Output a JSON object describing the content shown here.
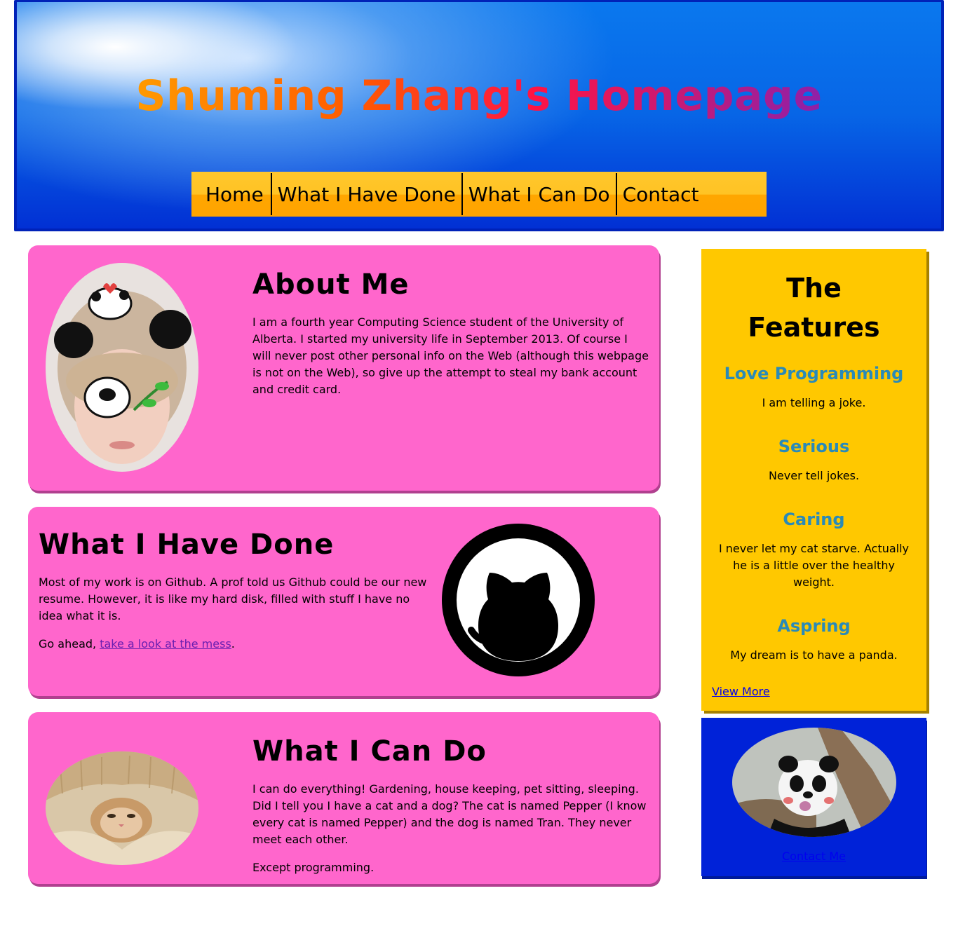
{
  "header": {
    "title": "Shuming Zhang's Homepage"
  },
  "nav": {
    "items": [
      {
        "label": "Home"
      },
      {
        "label": "What I Have Done"
      },
      {
        "label": "What I Can Do"
      },
      {
        "label": "Contact"
      }
    ]
  },
  "about": {
    "heading": "About Me",
    "text": "I am a fourth year Computing Science student of the University of Alberta. I started my university life in September 2013. Of course I will never post other personal info on the Web (although this webpage is not on the Web), so give up the attempt to steal my bank account and credit card."
  },
  "done": {
    "heading": "What I Have Done",
    "text": "Most of my work is on Github. A prof told us Github could be our new resume. However, it is like my hard disk, filled with stuff I have no idea what it is.",
    "go_prefix": "Go ahead, ",
    "link_label": "take a look at the mess",
    "go_suffix": "."
  },
  "can": {
    "heading": "What I Can Do",
    "text": "I can do everything! Gardening, house keeping, pet sitting, sleeping. Did I tell you I have a cat and a dog? The cat is named Pepper (I know every cat is named Pepper) and the dog is named Tran. They never meet each other.",
    "text2": "Except programming."
  },
  "features": {
    "title": "The Features",
    "items": [
      {
        "heading": "Love Programming",
        "text": "I am telling a joke."
      },
      {
        "heading": "Serious",
        "text": "Never tell jokes."
      },
      {
        "heading": "Caring",
        "text": "I never let my cat starve. Actually he is a little over the healthy weight."
      },
      {
        "heading": "Aspring",
        "text": "My dream is to have a panda."
      }
    ],
    "view_more": "View More"
  },
  "contact_box": {
    "link": "Contact Me"
  },
  "colors": {
    "card_pink": "#ff66cc",
    "sidebar_yellow": "#ffc800",
    "feature_heading": "#2a8ab8",
    "header_blue": "#0765e6",
    "nav_orange": "#ffa400"
  }
}
